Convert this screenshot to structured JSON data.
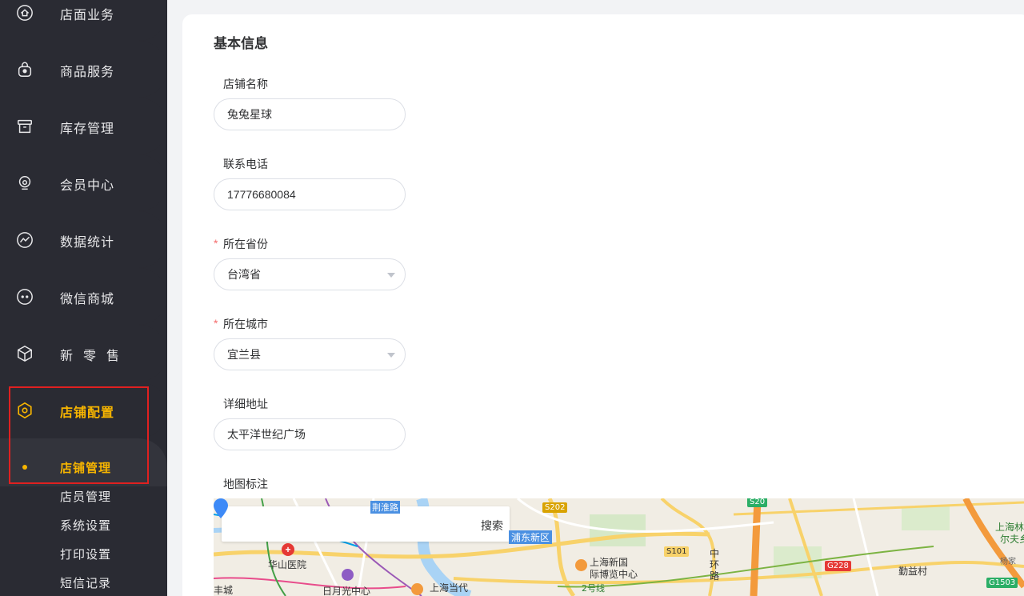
{
  "sidebar": {
    "items": [
      {
        "label": "店面业务",
        "icon": "home-icon"
      },
      {
        "label": "商品服务",
        "icon": "shopping-bag-icon"
      },
      {
        "label": "库存管理",
        "icon": "archive-icon"
      },
      {
        "label": "会员中心",
        "icon": "member-icon"
      },
      {
        "label": "数据统计",
        "icon": "chart-icon"
      },
      {
        "label": "微信商城",
        "icon": "wechat-icon"
      },
      {
        "label": "新零售",
        "icon": "cube-icon"
      },
      {
        "label": "店铺配置",
        "icon": "settings-icon"
      }
    ],
    "submenu": [
      {
        "label": "店铺管理"
      },
      {
        "label": "店员管理"
      },
      {
        "label": "系统设置"
      },
      {
        "label": "打印设置"
      },
      {
        "label": "短信记录"
      }
    ],
    "accent_color": "#f7b500",
    "highlight_box_color": "#e02020"
  },
  "form": {
    "section_title": "基本信息",
    "store_name": {
      "label": "店铺名称",
      "value": "兔兔星球"
    },
    "phone": {
      "label": "联系电话",
      "value": "17776680084"
    },
    "province": {
      "label": "所在省份",
      "value": "台湾省",
      "required_mark": "*"
    },
    "city": {
      "label": "所在城市",
      "value": "宜兰县",
      "required_mark": "*"
    },
    "address": {
      "label": "详细地址",
      "value": "太平洋世纪广场"
    },
    "map": {
      "label": "地图标注",
      "search_button": "搜索",
      "labels": [
        "华山医院",
        "日月光中心",
        "上海当代",
        "上海新国",
        "际博览中心",
        "浦东新区",
        "中",
        "环",
        "路",
        "勤益村",
        "上海林",
        "尔夫乡",
        "杨家",
        "丰城",
        "2号线",
        "荆淮路"
      ],
      "road_badges": [
        "S202",
        "S20",
        "S101",
        "G228",
        "G1503"
      ]
    }
  }
}
